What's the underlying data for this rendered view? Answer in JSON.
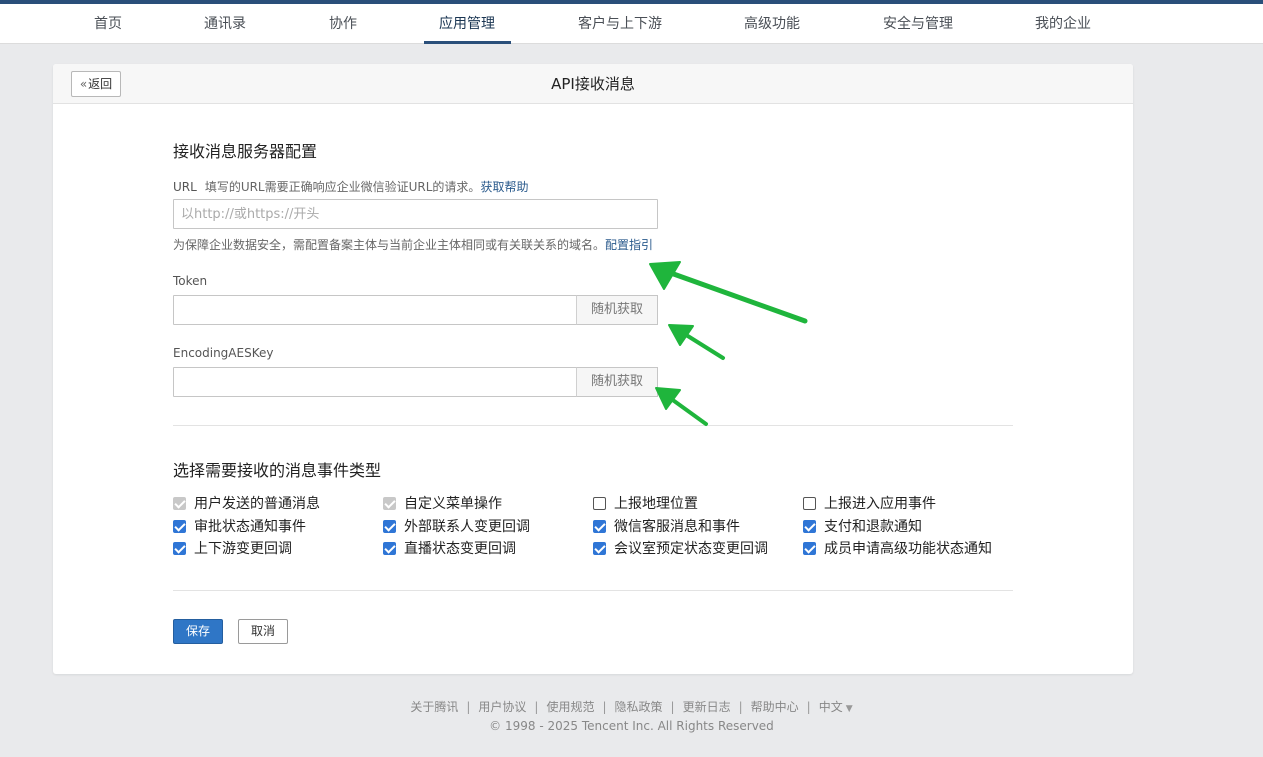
{
  "nav": {
    "items": [
      "首页",
      "通讯录",
      "协作",
      "应用管理",
      "客户与上下游",
      "高级功能",
      "安全与管理",
      "我的企业"
    ],
    "active_index": 3
  },
  "header": {
    "back_label": "返回",
    "title": "API接收消息"
  },
  "server_config": {
    "title": "接收消息服务器配置",
    "url_label": "URL",
    "url_desc": "填写的URL需要正确响应企业微信验证URL的请求。",
    "url_help_link": "获取帮助",
    "url_value": "",
    "url_placeholder": "以http://或https://开头",
    "domain_hint": "为保障企业数据安全，需配置备案主体与当前企业主体相同或有关联关系的域名。",
    "domain_hint_link": "配置指引",
    "token_label": "Token",
    "token_value": "",
    "token_button": "随机获取",
    "aeskey_label": "EncodingAESKey",
    "aeskey_value": "",
    "aeskey_button": "随机获取"
  },
  "events": {
    "title": "选择需要接收的消息事件类型",
    "items": [
      {
        "label": "用户发送的普通消息",
        "state": "disabled-checked"
      },
      {
        "label": "自定义菜单操作",
        "state": "disabled-checked"
      },
      {
        "label": "上报地理位置",
        "state": "unchecked"
      },
      {
        "label": "上报进入应用事件",
        "state": "unchecked"
      },
      {
        "label": "审批状态通知事件",
        "state": "checked"
      },
      {
        "label": "外部联系人变更回调",
        "state": "checked"
      },
      {
        "label": "微信客服消息和事件",
        "state": "checked"
      },
      {
        "label": "支付和退款通知",
        "state": "checked"
      },
      {
        "label": "上下游变更回调",
        "state": "checked"
      },
      {
        "label": "直播状态变更回调",
        "state": "checked"
      },
      {
        "label": "会议室预定状态变更回调",
        "state": "checked"
      },
      {
        "label": "成员申请高级功能状态通知",
        "state": "checked"
      }
    ]
  },
  "actions": {
    "save_label": "保存",
    "cancel_label": "取消"
  },
  "footer": {
    "links": [
      "关于腾讯",
      "用户协议",
      "使用规范",
      "隐私政策",
      "更新日志",
      "帮助中心",
      "中文"
    ],
    "copyright": "© 1998 - 2025 Tencent Inc. All Rights Reserved"
  },
  "colors": {
    "accent": "#2a4f7a",
    "primary_button": "#2f76c6",
    "checkbox_checked": "#2f76d6",
    "annotation_arrow": "#1fb53c"
  }
}
